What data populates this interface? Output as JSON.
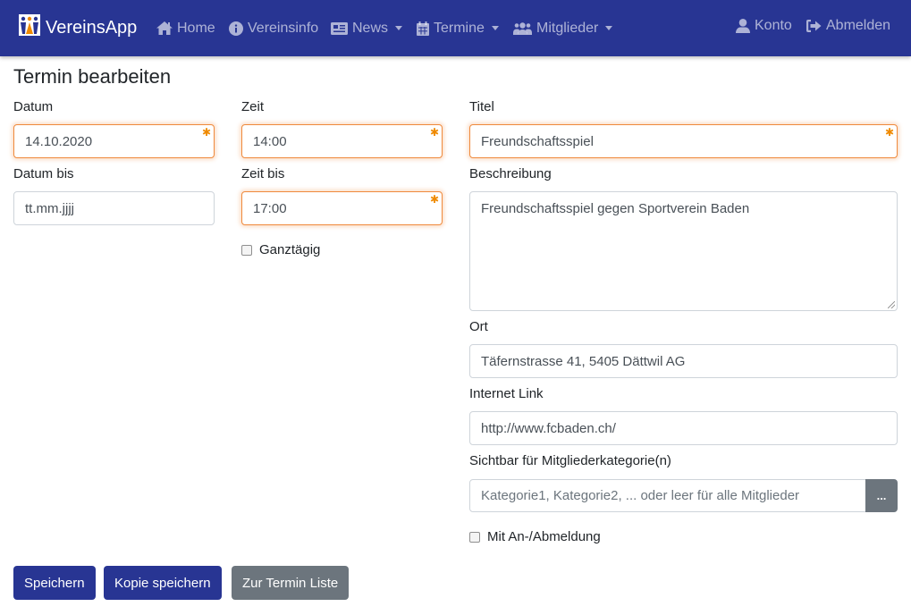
{
  "navbar": {
    "brand": "VereinsApp",
    "items": [
      {
        "label": "Home",
        "icon": "home-icon"
      },
      {
        "label": "Vereinsinfo",
        "icon": "info-circle-icon"
      },
      {
        "label": "News",
        "icon": "newspaper-icon",
        "dropdown": true
      },
      {
        "label": "Termine",
        "icon": "calendar-icon",
        "dropdown": true
      },
      {
        "label": "Mitglieder",
        "icon": "users-icon",
        "dropdown": true
      }
    ],
    "right": [
      {
        "label": "Konto",
        "icon": "user-icon"
      },
      {
        "label": "Abmelden",
        "icon": "sign-out-icon"
      }
    ],
    "color": "#283593"
  },
  "page": {
    "title": "Termin bearbeiten"
  },
  "form": {
    "datum": {
      "label": "Datum",
      "value": "14.10.2020",
      "required": true
    },
    "datum_bis": {
      "label": "Datum bis",
      "placeholder": "tt.mm.jjjj"
    },
    "zeit": {
      "label": "Zeit",
      "value": "14:00",
      "required": true
    },
    "zeit_bis": {
      "label": "Zeit bis",
      "value": "17:00",
      "required": true
    },
    "ganztaegig": {
      "label": "Ganztägig",
      "checked": false
    },
    "titel": {
      "label": "Titel",
      "value": "Freundschaftsspiel",
      "required": true
    },
    "beschreibung": {
      "label": "Beschreibung",
      "value": "Freundschaftsspiel gegen Sportverein Baden"
    },
    "ort": {
      "label": "Ort",
      "value": "Täfernstrasse 41, 5405 Dättwil AG"
    },
    "link": {
      "label": "Internet Link",
      "value": "http://www.fcbaden.ch/"
    },
    "kategorie": {
      "label": "Sichtbar für Mitgliederkategorie(n)",
      "placeholder": "Kategorie1, Kategorie2, ... oder leer für alle Mitglieder",
      "button": "..."
    },
    "anmeldung": {
      "label": "Mit An-/Abmeldung",
      "checked": false
    },
    "required_marker": "✱"
  },
  "buttons": {
    "save": "Speichern",
    "save_copy": "Kopie speichern",
    "back": "Zur Termin Liste"
  }
}
